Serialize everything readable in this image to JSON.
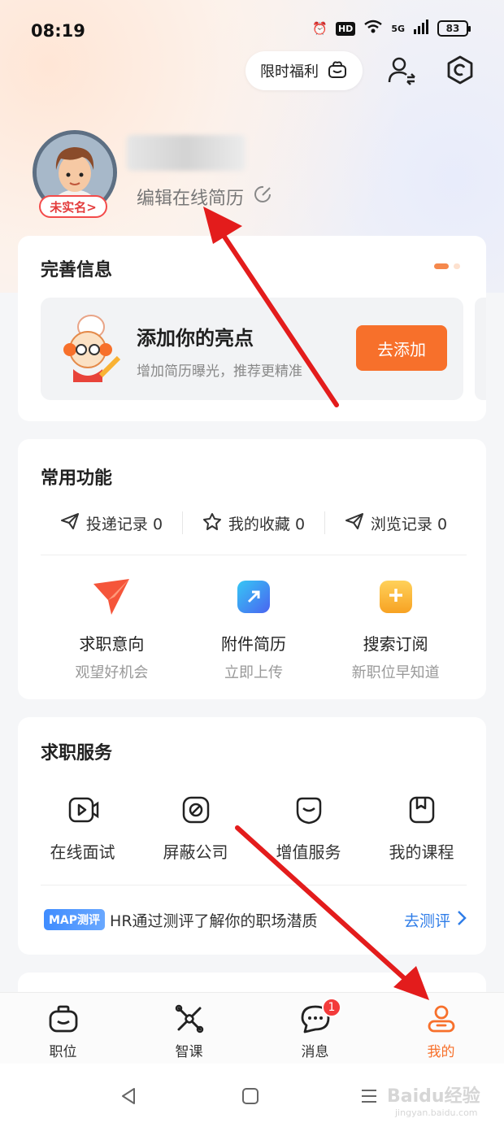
{
  "status_bar": {
    "time": "08:19",
    "hd": "HD",
    "network": "5G",
    "battery": "83"
  },
  "header": {
    "promo_label": "限时福利",
    "icons": [
      "gift-icon",
      "switch-identity-icon",
      "settings-icon"
    ]
  },
  "profile": {
    "realname_tag": "未实名>",
    "edit_resume": "编辑在线简历"
  },
  "info_card": {
    "title": "完善信息",
    "highlight_title": "添加你的亮点",
    "highlight_sub": "增加简历曝光，推荐更精准",
    "add_button": "去添加"
  },
  "func_card": {
    "title": "常用功能",
    "stats": [
      {
        "label": "投递记录 0",
        "icon": "send-icon"
      },
      {
        "label": "我的收藏 0",
        "icon": "star-icon"
      },
      {
        "label": "浏览记录 0",
        "icon": "history-icon"
      }
    ],
    "tools": [
      {
        "label": "求职意向",
        "sub": "观望好机会",
        "icon": "intent-icon",
        "color": "#f5553a"
      },
      {
        "label": "附件简历",
        "sub": "立即上传",
        "icon": "attachment-icon",
        "color": "#3e7cf7"
      },
      {
        "label": "搜索订阅",
        "sub": "新职位早知道",
        "icon": "subscribe-icon",
        "color": "#f9b234"
      }
    ]
  },
  "service_card": {
    "title": "求职服务",
    "items": [
      {
        "label": "在线面试",
        "icon": "video-interview-icon"
      },
      {
        "label": "屏蔽公司",
        "icon": "block-icon"
      },
      {
        "label": "增值服务",
        "icon": "vip-service-icon"
      },
      {
        "label": "我的课程",
        "icon": "course-icon"
      }
    ],
    "map_badge": "MAP测评",
    "map_text": "HR通过测评了解你的职场潜质",
    "map_link": "去测评"
  },
  "bottom_nav": {
    "items": [
      {
        "label": "职位",
        "icon": "job-icon",
        "active": false
      },
      {
        "label": "智课",
        "icon": "course-tab-icon",
        "active": false
      },
      {
        "label": "消息",
        "icon": "message-icon",
        "active": false,
        "badge": "1"
      },
      {
        "label": "我的",
        "icon": "profile-icon",
        "active": true
      }
    ]
  },
  "watermark": {
    "text": "Baidu经验",
    "sub": "jingyan.baidu.com"
  },
  "colors": {
    "accent": "#f7702b",
    "annotation_arrow": "#e31c1c",
    "link": "#2f7de8"
  }
}
